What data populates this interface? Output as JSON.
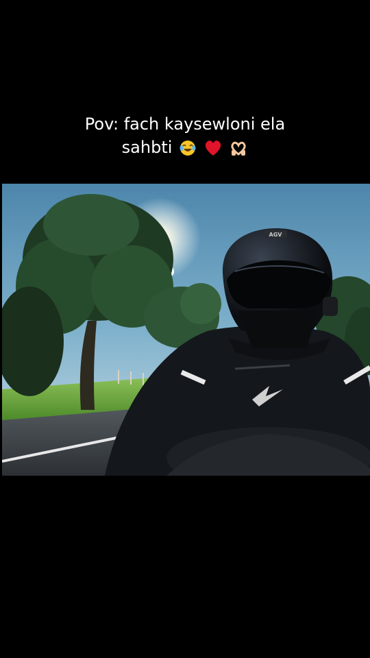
{
  "caption": {
    "line1": "Pov: fach kaysewloni ela",
    "line2": "sahbti"
  },
  "emojis": [
    "face-with-tears-of-joy-icon",
    "red-heart-icon",
    "heart-hands-icon"
  ],
  "helmet_badge": "AGV",
  "colors": {
    "background": "#000000",
    "caption_text": "#ffffff",
    "sky": "#4f8fb0",
    "grass": "#6aa83a",
    "road": "#3a3f44"
  }
}
